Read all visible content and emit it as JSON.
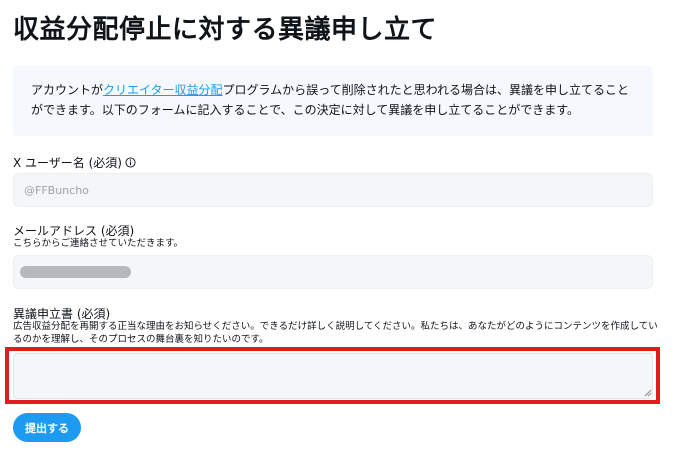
{
  "page": {
    "title": "収益分配停止に対する異議申し立て"
  },
  "notice": {
    "text_before_link": "アカウントが",
    "link_text": "クリエイター収益分配",
    "text_after_link": "プログラムから誤って削除されたと思われる場合は、異議を申し立てることができます。以下のフォームに記入することで、この決定に対して異議を申し立てることができます。"
  },
  "username_field": {
    "label": "X ユーザー名 (必須)",
    "icon": "info-icon",
    "placeholder": "@FFBuncho"
  },
  "email_field": {
    "label": "メールアドレス (必須)",
    "help": "こちらからご連絡させていただきます。"
  },
  "appeal_field": {
    "label": "異議申立書 (必須)",
    "help": "広告収益分配を再開する正当な理由をお知らせください。できるだけ詳しく説明してください。私たちは、あなたがどのようにコンテンツを作成しているのかを理解し、そのプロセスの舞台裏を知りたいのです。"
  },
  "submit": {
    "label": "提出する"
  },
  "colors": {
    "accent": "#1d9bf0",
    "highlight": "#e01c1c",
    "notice_bg": "#f5f8fc",
    "input_bg": "#f4f6f7"
  }
}
